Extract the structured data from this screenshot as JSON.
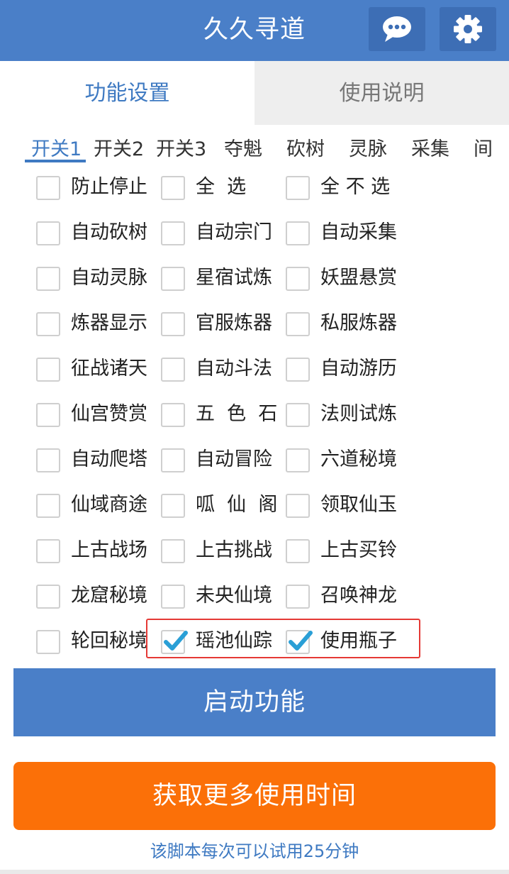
{
  "header": {
    "title": "久久寻道",
    "chat_icon": "chat-bubble-icon",
    "settings_icon": "gear-icon",
    "color": "#4a7fc8"
  },
  "tabs": [
    {
      "label": "功能设置",
      "active": true
    },
    {
      "label": "使用说明",
      "active": false
    }
  ],
  "subtabs": [
    "开关1",
    "开关2",
    "开关3",
    "夺魁",
    "砍树",
    "灵脉",
    "采集",
    "间"
  ],
  "options": [
    [
      {
        "label": "防止停止",
        "checked": false
      },
      {
        "label": "全  选",
        "checked": false
      },
      {
        "label": "全 不 选",
        "checked": false
      }
    ],
    [
      {
        "label": "自动砍树",
        "checked": false
      },
      {
        "label": "自动宗门",
        "checked": false
      },
      {
        "label": "自动采集",
        "checked": false
      }
    ],
    [
      {
        "label": "自动灵脉",
        "checked": false
      },
      {
        "label": "星宿试炼",
        "checked": false
      },
      {
        "label": "妖盟悬赏",
        "checked": false
      }
    ],
    [
      {
        "label": "炼器显示",
        "checked": false
      },
      {
        "label": "官服炼器",
        "checked": false
      },
      {
        "label": "私服炼器",
        "checked": false
      }
    ],
    [
      {
        "label": "征战诸天",
        "checked": false
      },
      {
        "label": "自动斗法",
        "checked": false
      },
      {
        "label": "自动游历",
        "checked": false
      }
    ],
    [
      {
        "label": "仙宫赞赏",
        "checked": false
      },
      {
        "label": "五  色  石",
        "checked": false
      },
      {
        "label": "法则试炼",
        "checked": false
      }
    ],
    [
      {
        "label": "自动爬塔",
        "checked": false
      },
      {
        "label": "自动冒险",
        "checked": false
      },
      {
        "label": "六道秘境",
        "checked": false
      }
    ],
    [
      {
        "label": "仙域商途",
        "checked": false
      },
      {
        "label": "呱  仙  阁",
        "checked": false
      },
      {
        "label": "领取仙玉",
        "checked": false
      }
    ],
    [
      {
        "label": "上古战场",
        "checked": false
      },
      {
        "label": "上古挑战",
        "checked": false
      },
      {
        "label": "上古买铃",
        "checked": false
      }
    ],
    [
      {
        "label": "龙窟秘境",
        "checked": false
      },
      {
        "label": "未央仙境",
        "checked": false
      },
      {
        "label": "召唤神龙",
        "checked": false
      }
    ],
    [
      {
        "label": "轮回秘境",
        "checked": false
      },
      {
        "label": "瑶池仙踪",
        "checked": true
      },
      {
        "label": "使用瓶子",
        "checked": true
      }
    ]
  ],
  "buttons": {
    "start": "启动功能",
    "more_time": "获取更多使用时间"
  },
  "footer": {
    "note": "该脚本每次可以试用25分钟"
  },
  "colors": {
    "accent": "#4a7fc8",
    "orange": "#fb7008",
    "highlight": "#e53935",
    "check": "#2a9fd6"
  }
}
